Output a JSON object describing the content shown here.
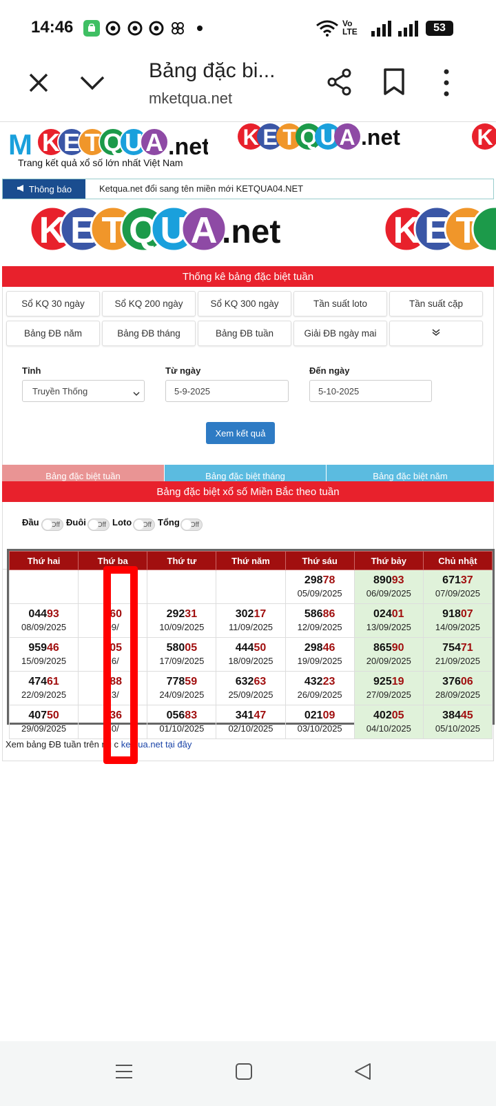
{
  "status": {
    "time": "14:46",
    "network": "Vo LTE",
    "battery": "53"
  },
  "browser": {
    "title": "Bảng đặc bi...",
    "url": "mketqua.net"
  },
  "site": {
    "logo_main": "MKETQUA.net",
    "logo_letters": [
      "M",
      "K",
      "E",
      "T",
      "Q",
      "U",
      "A"
    ],
    "logo_suffix": ".net",
    "slogan": "Trang kết quả xổ số lớn nhất Việt Nam",
    "banner_letters": [
      "K",
      "E",
      "T",
      "Q",
      "U",
      "A"
    ]
  },
  "notice": {
    "tag": "Thông báo",
    "text": "Ketqua.net đổi sang tên miền mới KETQUA04.NET"
  },
  "section_title": "Thống kê bảng đặc biệt tuần",
  "nav_buttons": [
    "Sổ KQ 30 ngày",
    "Sổ KQ 200 ngày",
    "Sổ KQ 300 ngày",
    "Tần suất loto",
    "Tần suất cặp",
    "Bảng ĐB năm",
    "Bảng ĐB tháng",
    "Bảng ĐB tuần",
    "Giải ĐB ngày mai"
  ],
  "form": {
    "province_label": "Tỉnh",
    "province_value": "Truyền Thống",
    "from_label": "Từ ngày",
    "from_value": "5-9-2025",
    "to_label": "Đến ngày",
    "to_value": "5-10-2025",
    "submit": "Xem kết quả"
  },
  "tabs": [
    "Bảng đặc biệt tuần",
    "Bảng đặc biệt tháng",
    "Bảng đặc biệt năm"
  ],
  "table_title": "Bảng đặc biệt xổ số Miền Bắc theo tuần",
  "toggles": [
    {
      "label": "Đầu",
      "state": "Off"
    },
    {
      "label": "Đuôi",
      "state": "Off"
    },
    {
      "label": "Loto",
      "state": "Off"
    },
    {
      "label": "Tổng",
      "state": "Off"
    }
  ],
  "table": {
    "headers": [
      "Thứ hai",
      "Thứ ba",
      "Thứ tư",
      "Thứ năm",
      "Thứ sáu",
      "Thứ bảy",
      "Chủ nhật"
    ],
    "rows": [
      [
        null,
        null,
        null,
        null,
        {
          "a": "298",
          "b": "78",
          "d": "05/09/2025"
        },
        {
          "a": "890",
          "b": "93",
          "d": "06/09/2025"
        },
        {
          "a": "671",
          "b": "37",
          "d": "07/09/2025"
        }
      ],
      [
        {
          "a": "044",
          "b": "93",
          "d": "08/09/2025"
        },
        {
          "a": "0",
          "b": "60",
          "d": "09/"
        },
        {
          "a": "292",
          "b": "31",
          "d": "10/09/2025"
        },
        {
          "a": "302",
          "b": "17",
          "d": "11/09/2025"
        },
        {
          "a": "586",
          "b": "86",
          "d": "12/09/2025"
        },
        {
          "a": "024",
          "b": "01",
          "d": "13/09/2025"
        },
        {
          "a": "918",
          "b": "07",
          "d": "14/09/2025"
        }
      ],
      [
        {
          "a": "959",
          "b": "46",
          "d": "15/09/2025"
        },
        {
          "a": "1",
          "b": "05",
          "d": "16/"
        },
        {
          "a": "580",
          "b": "05",
          "d": "17/09/2025"
        },
        {
          "a": "444",
          "b": "50",
          "d": "18/09/2025"
        },
        {
          "a": "298",
          "b": "46",
          "d": "19/09/2025"
        },
        {
          "a": "865",
          "b": "90",
          "d": "20/09/2025"
        },
        {
          "a": "754",
          "b": "71",
          "d": "21/09/2025"
        }
      ],
      [
        {
          "a": "474",
          "b": "61",
          "d": "22/09/2025"
        },
        {
          "a": "3",
          "b": "88",
          "d": "23/"
        },
        {
          "a": "778",
          "b": "59",
          "d": "24/09/2025"
        },
        {
          "a": "632",
          "b": "63",
          "d": "25/09/2025"
        },
        {
          "a": "432",
          "b": "23",
          "d": "26/09/2025"
        },
        {
          "a": "925",
          "b": "19",
          "d": "27/09/2025"
        },
        {
          "a": "376",
          "b": "06",
          "d": "28/09/2025"
        }
      ],
      [
        {
          "a": "407",
          "b": "50",
          "d": "29/09/2025"
        },
        {
          "a": "8",
          "b": "36",
          "d": "30/"
        },
        {
          "a": "056",
          "b": "83",
          "d": "01/10/2025"
        },
        {
          "a": "341",
          "b": "47",
          "d": "02/10/2025"
        },
        {
          "a": "021",
          "b": "09",
          "d": "03/10/2025"
        },
        {
          "a": "402",
          "b": "05",
          "d": "04/10/2025"
        },
        {
          "a": "384",
          "b": "45",
          "d": "05/10/2025"
        }
      ]
    ]
  },
  "footer": {
    "prefix": "Xem bảng ĐB tuần trên",
    "middle": "ng c",
    "link": "ketqua.net tại đây"
  },
  "colors": {
    "logo_balls": [
      "#e8212c",
      "#3a56a6",
      "#f0962a",
      "#1c9a4a",
      "#1aa0dc",
      "#8e4aa5"
    ],
    "header_red": "#a10f0f",
    "bar_red": "#e8212c",
    "weekend_green": "#e0f2da",
    "tab_active": "#e99494",
    "tab_inactive": "#5bbbe0",
    "button_blue": "#2e7bc4",
    "highlight_box": "#ff0000"
  },
  "icons": [
    "close-icon",
    "chevron-down-icon",
    "share-icon",
    "bookmark-icon",
    "more-vert-icon",
    "wifi-icon",
    "signal-icon",
    "battery-icon",
    "megaphone-icon",
    "menu-nav-icon",
    "home-nav-icon",
    "back-nav-icon"
  ]
}
